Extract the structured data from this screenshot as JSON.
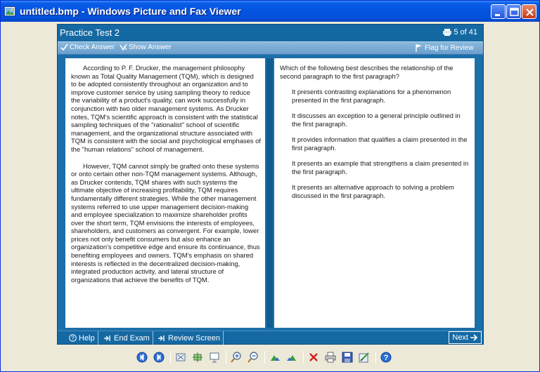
{
  "window": {
    "title": "untitled.bmp - Windows Picture and Fax Viewer",
    "title_bar_color": "#0A5DE8"
  },
  "app": {
    "title": "Practice Test 2",
    "counter": "5 of 41",
    "accent": "#1C6FA8",
    "toolbar": {
      "check_answer": "Check Answer",
      "show_answer": "Show Answer",
      "flag_for_review": "Flag for Review"
    },
    "passage": {
      "paragraphs": [
        "According to P. F. Drucker, the management philosophy known as Total Quality Management (TQM), which is designed to be adopted consistently throughout an organization and to improve customer service by using sampling theory to reduce the variability of a product's quality, can work successfully in conjunction with two older management systems.  As Drucker notes, TQM's scientific approach is consistent with the statistical sampling techniques of the \"rationalist\" school of scientific management, and the organizational structure associated with TQM is consistent with the social and psychological emphases of the \"human relations\" school of management.",
        "However, TQM cannot simply be grafted onto these systems or onto certain other non-TQM management systems.  Although, as Drucker contends, TQM shares with such systems the ultimate objective of increasing profitability, TQM requires fundamentally different strategies.  While the other management systems referred to use upper management decision-making and employee specialization to maximize shareholder profits over the short term, TQM envisions the interests of employees, shareholders, and customers as convergent.  For example, lower prices not only benefit consumers but also enhance an organization's competitive edge and ensure its continuance, thus benefiting employees and owners.  TQM's emphasis on shared interests is reflected in the decentralized decision-making, integrated production activity, and lateral structure of organizations that achieve the benefits of TQM."
      ]
    },
    "question": {
      "text": "Which of the following best describes the relationship of the second paragraph to the first paragraph?",
      "choices": [
        "It presents contrasting explanations for a phenomenon presented in the first paragraph.",
        "It discusses an exception to a general principle outlined in the first paragraph.",
        "It provides information that qualifies a claim presented in the first paragraph.",
        "It presents an example that strengthens a claim presented in the first paragraph.",
        "It presents an alternative approach to solving a problem discussed in the first paragraph."
      ]
    },
    "footer": {
      "help": "Help",
      "end_exam": "End Exam",
      "review_screen": "Review Screen",
      "next": "Next"
    }
  },
  "viewer_toolbar": {
    "icons": [
      "previous-image-icon",
      "next-image-icon",
      "best-fit-icon",
      "actual-size-icon",
      "slideshow-icon",
      "zoom-in-icon",
      "zoom-out-icon",
      "rotate-clockwise-icon",
      "rotate-counterclockwise-icon",
      "delete-icon",
      "print-icon",
      "save-icon",
      "edit-icon",
      "help-icon"
    ]
  }
}
